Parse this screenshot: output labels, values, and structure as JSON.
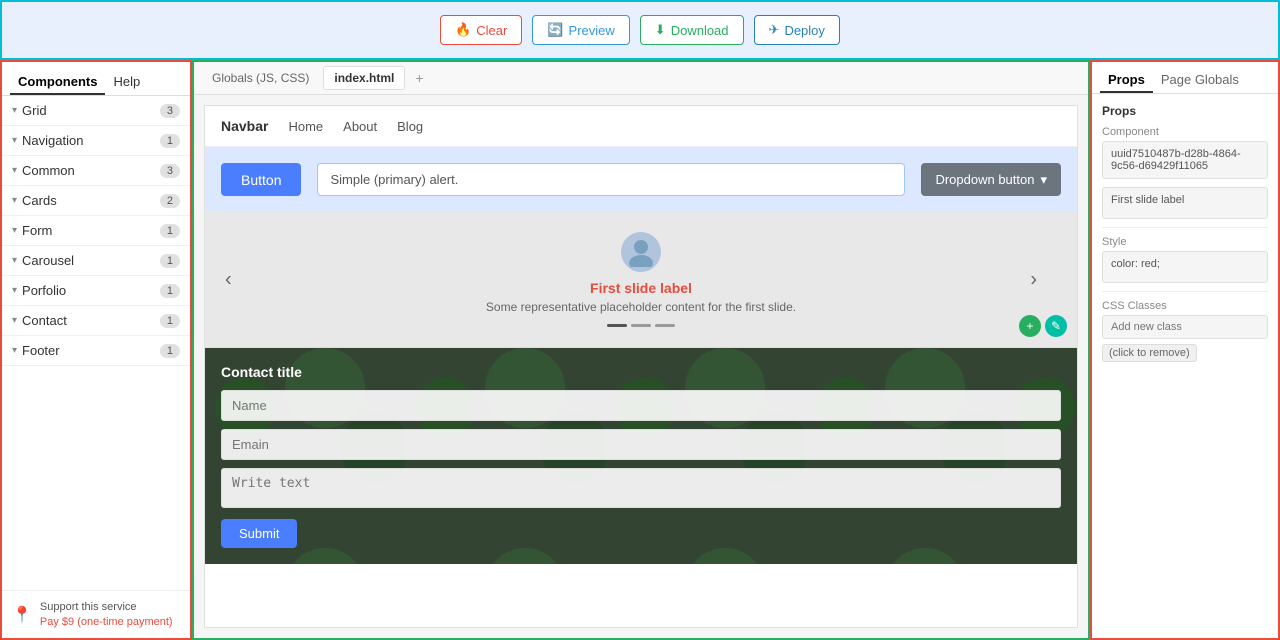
{
  "toolbar": {
    "clear_label": "Clear",
    "preview_label": "Preview",
    "download_label": "Download",
    "deploy_label": "Deploy"
  },
  "left_sidebar": {
    "tab_components": "Components",
    "tab_help": "Help",
    "sections": [
      {
        "label": "Grid",
        "count": 3
      },
      {
        "label": "Navigation",
        "count": 1
      },
      {
        "label": "Common",
        "count": 3
      },
      {
        "label": "Cards",
        "count": 2
      },
      {
        "label": "Form",
        "count": 1
      },
      {
        "label": "Carousel",
        "count": 1
      },
      {
        "label": "Porfolio",
        "count": 1
      },
      {
        "label": "Contact",
        "count": 1
      },
      {
        "label": "Footer",
        "count": 1
      }
    ],
    "support_text": "Support this service",
    "support_link": "Pay $9 (one-time payment)"
  },
  "canvas": {
    "tab_globals": "Globals (JS, CSS)",
    "tab_index": "index.html",
    "tab_add": "+",
    "navbar": {
      "brand": "Navbar",
      "links": [
        "Home",
        "About",
        "Blog"
      ]
    },
    "button_label": "Button",
    "alert_text": "Simple (primary) alert.",
    "dropdown_label": "Dropdown button",
    "carousel": {
      "label": "First slide label",
      "description": "Some representative placeholder content for the first slide.",
      "prev": "‹",
      "next": "›"
    },
    "contact": {
      "title": "Contact title",
      "name_placeholder": "Name",
      "email_placeholder": "Emain",
      "textarea_placeholder": "Write text",
      "submit_label": "Submit"
    }
  },
  "right_sidebar": {
    "tab_props": "Props",
    "tab_page_globals": "Page Globals",
    "props_title": "Props",
    "component_label": "Component",
    "component_value": "uuid7510487b-d28b-4864-9c56-d69429f11065",
    "first_slide_label": "First slide label",
    "style_label": "Style",
    "style_value": "color: red;",
    "css_classes_label": "CSS Classes",
    "add_class_placeholder": "Add new class",
    "click_to_remove": "(click to remove)"
  }
}
